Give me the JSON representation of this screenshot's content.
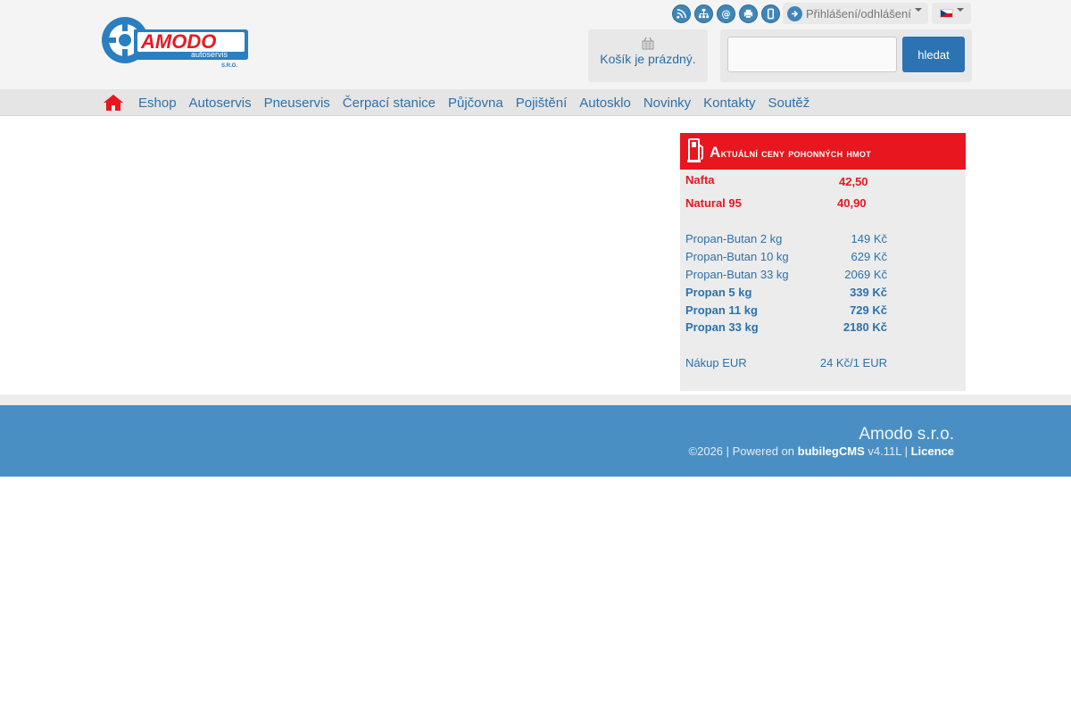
{
  "header": {
    "logo": {
      "brand": "AMODO",
      "tagline": "autoservis",
      "suffix": "S.R.O.",
      "colors": {
        "blue": "#2a7fc1",
        "red": "#e41b23"
      }
    },
    "top_icons": [
      "rss-icon",
      "sitemap-icon",
      "email-icon",
      "print-icon",
      "mobile-icon"
    ],
    "login": {
      "label": "Přihlášení/odhlášení"
    },
    "language": {
      "selected": "cs"
    },
    "cart": {
      "text": "Košík je prázdný."
    },
    "search": {
      "placeholder": "",
      "button": "hledat"
    }
  },
  "nav": {
    "items": [
      "Eshop",
      "Autoservis",
      "Pneuservis",
      "Čerpací stanice",
      "Půjčovna",
      "Pojištění",
      "Autosklo",
      "Novinky",
      "Kontakty",
      "Soutěž"
    ]
  },
  "fuel": {
    "title": "Aktuální ceny pohonných hmot",
    "main": [
      {
        "name": "Nafta",
        "price": "42,50"
      },
      {
        "name": "Natural 95",
        "price": "40,90"
      }
    ],
    "gas_light": [
      {
        "name": "Propan-Butan 2 kg",
        "price": "149 Kč"
      },
      {
        "name": "Propan-Butan 10 kg",
        "price": "629 Kč"
      },
      {
        "name": "Propan-Butan 33 kg",
        "price": "2069 Kč"
      }
    ],
    "gas_bold": [
      {
        "name": "Propan 5 kg",
        "price": "339 Kč"
      },
      {
        "name": "Propan 11 kg",
        "price": "729 Kč"
      },
      {
        "name": "Propan 33 kg",
        "price": "2180 Kč"
      }
    ],
    "exchange": {
      "name": "Nákup EUR",
      "value": "24 Kč/1 EUR"
    }
  },
  "footer": {
    "company": "Amodo s.r.o.",
    "copyright": "©2026 | Powered on",
    "cms": "bubilegCMS",
    "version": "v4.11L |",
    "licence": "Licence"
  },
  "colors": {
    "accent_blue": "#2c72ad",
    "fuel_red": "#e8161f",
    "footer_blue": "#4a8fc4"
  }
}
